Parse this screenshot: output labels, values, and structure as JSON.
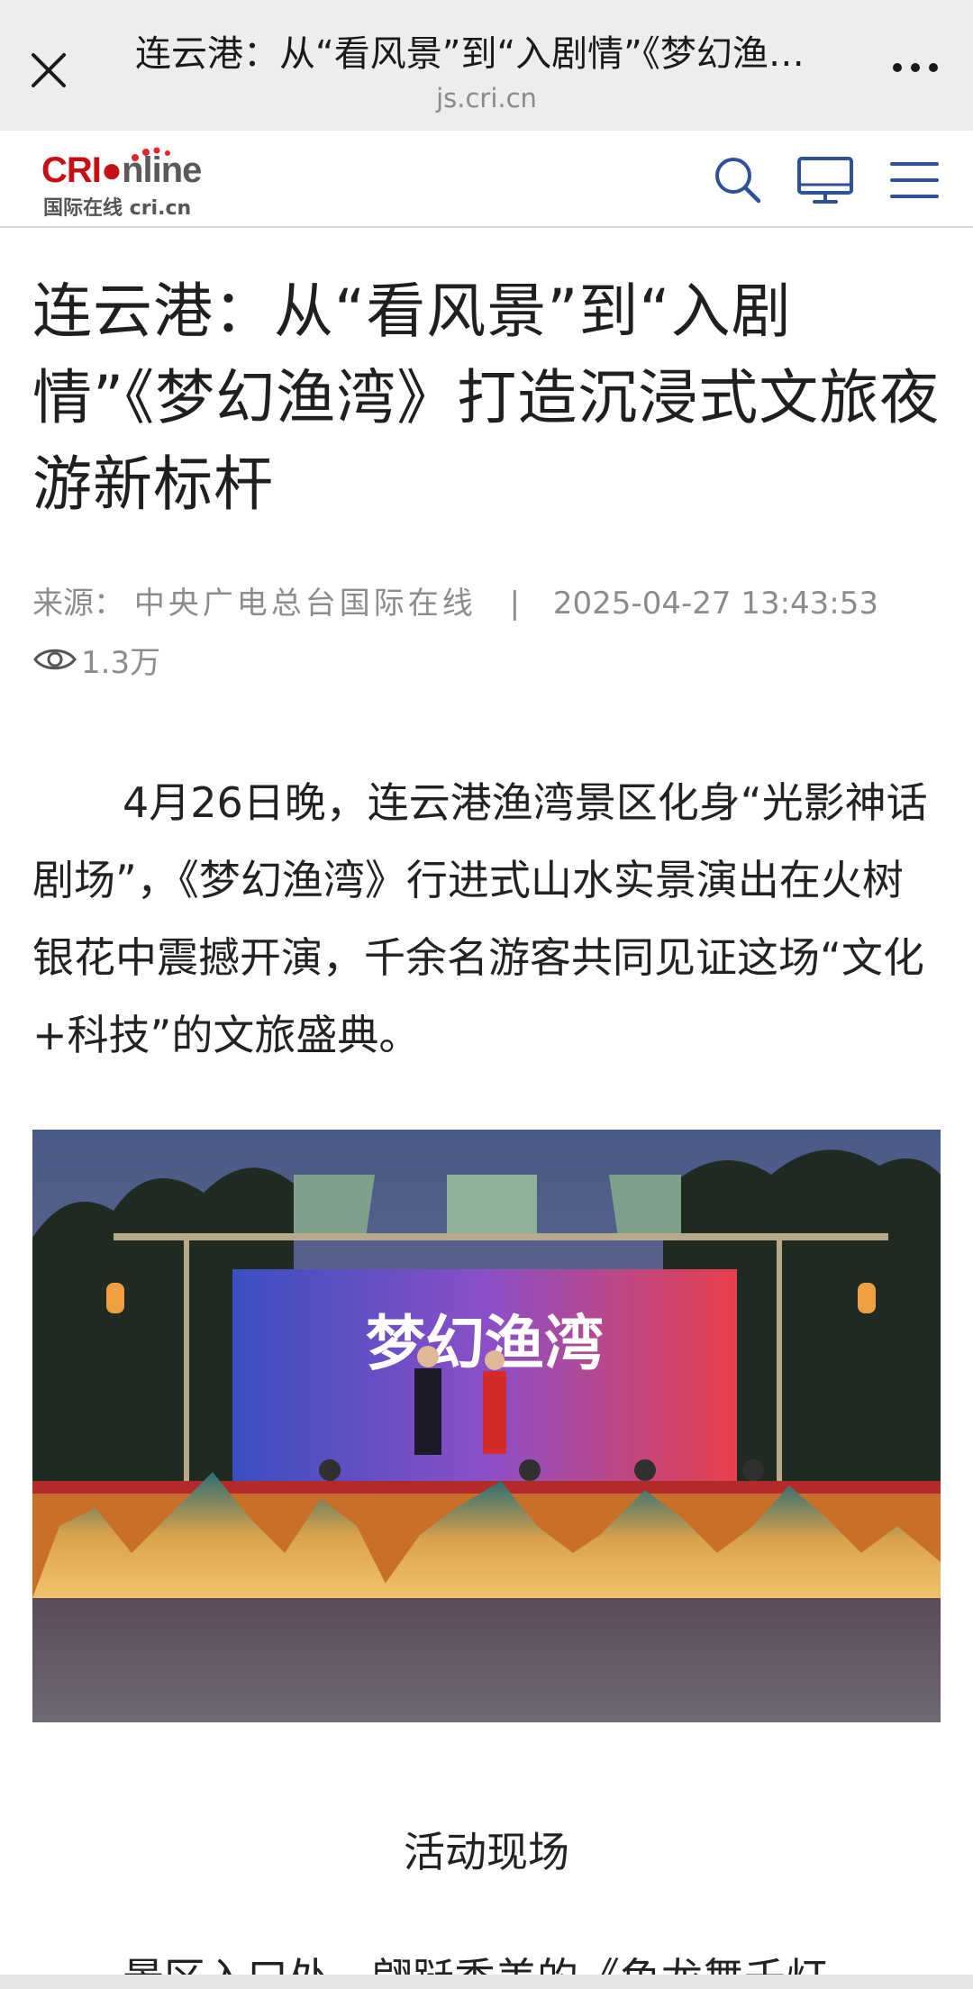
{
  "browser": {
    "title": "连云港：从“看风景”到“入剧情”《梦幻渔湾》打造沉浸式文旅夜游新标杆",
    "domain": "js.cri.cn",
    "close_icon": "close-icon",
    "more_icon": "more-icon"
  },
  "site": {
    "logo_brand_prefix": "CRI",
    "logo_brand_suffix": "nline",
    "logo_sub": "国际在线 cri.cn",
    "icons": [
      "search-icon",
      "monitor-icon",
      "menu-icon"
    ],
    "accent_color": "#2c4f9e",
    "brand_red": "#c40f14"
  },
  "article": {
    "headline": "连云港：从“看风景”到“入剧情”《梦幻渔湾》打造沉浸式文旅夜游新标杆",
    "source_label": "来源：",
    "source": "中央广电总台国际在线",
    "separator": "|",
    "datetime": "2025-04-27 13:43:53",
    "views": "1.3万",
    "paragraph1": "4月26日晚，连云港渔湾景区化身“光影神话剧场”，《梦幻渔湾》行进式山水实景演出在火树银花中震撼开演，千余名游客共同见证这场“文化+科技”的文旅盛典。",
    "image_banner_title": "梦幻渔湾",
    "caption": "活动现场",
    "paragraph2_partial": "景区入口处，翩跹秀美的《鱼龙舞千灯"
  }
}
